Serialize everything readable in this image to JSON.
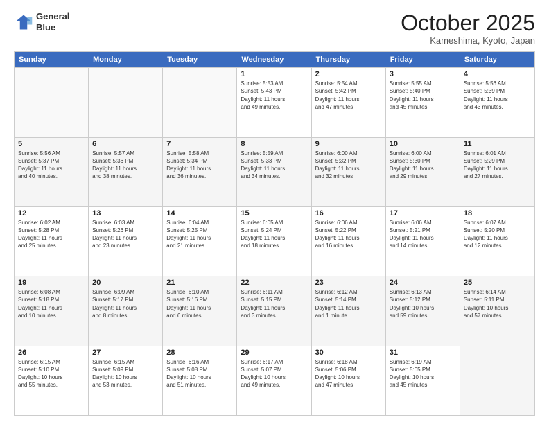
{
  "logo": {
    "line1": "General",
    "line2": "Blue"
  },
  "title": "October 2025",
  "location": "Kameshima, Kyoto, Japan",
  "headers": [
    "Sunday",
    "Monday",
    "Tuesday",
    "Wednesday",
    "Thursday",
    "Friday",
    "Saturday"
  ],
  "weeks": [
    [
      {
        "day": "",
        "info": ""
      },
      {
        "day": "",
        "info": ""
      },
      {
        "day": "",
        "info": ""
      },
      {
        "day": "1",
        "info": "Sunrise: 5:53 AM\nSunset: 5:43 PM\nDaylight: 11 hours\nand 49 minutes."
      },
      {
        "day": "2",
        "info": "Sunrise: 5:54 AM\nSunset: 5:42 PM\nDaylight: 11 hours\nand 47 minutes."
      },
      {
        "day": "3",
        "info": "Sunrise: 5:55 AM\nSunset: 5:40 PM\nDaylight: 11 hours\nand 45 minutes."
      },
      {
        "day": "4",
        "info": "Sunrise: 5:56 AM\nSunset: 5:39 PM\nDaylight: 11 hours\nand 43 minutes."
      }
    ],
    [
      {
        "day": "5",
        "info": "Sunrise: 5:56 AM\nSunset: 5:37 PM\nDaylight: 11 hours\nand 40 minutes."
      },
      {
        "day": "6",
        "info": "Sunrise: 5:57 AM\nSunset: 5:36 PM\nDaylight: 11 hours\nand 38 minutes."
      },
      {
        "day": "7",
        "info": "Sunrise: 5:58 AM\nSunset: 5:34 PM\nDaylight: 11 hours\nand 36 minutes."
      },
      {
        "day": "8",
        "info": "Sunrise: 5:59 AM\nSunset: 5:33 PM\nDaylight: 11 hours\nand 34 minutes."
      },
      {
        "day": "9",
        "info": "Sunrise: 6:00 AM\nSunset: 5:32 PM\nDaylight: 11 hours\nand 32 minutes."
      },
      {
        "day": "10",
        "info": "Sunrise: 6:00 AM\nSunset: 5:30 PM\nDaylight: 11 hours\nand 29 minutes."
      },
      {
        "day": "11",
        "info": "Sunrise: 6:01 AM\nSunset: 5:29 PM\nDaylight: 11 hours\nand 27 minutes."
      }
    ],
    [
      {
        "day": "12",
        "info": "Sunrise: 6:02 AM\nSunset: 5:28 PM\nDaylight: 11 hours\nand 25 minutes."
      },
      {
        "day": "13",
        "info": "Sunrise: 6:03 AM\nSunset: 5:26 PM\nDaylight: 11 hours\nand 23 minutes."
      },
      {
        "day": "14",
        "info": "Sunrise: 6:04 AM\nSunset: 5:25 PM\nDaylight: 11 hours\nand 21 minutes."
      },
      {
        "day": "15",
        "info": "Sunrise: 6:05 AM\nSunset: 5:24 PM\nDaylight: 11 hours\nand 18 minutes."
      },
      {
        "day": "16",
        "info": "Sunrise: 6:06 AM\nSunset: 5:22 PM\nDaylight: 11 hours\nand 16 minutes."
      },
      {
        "day": "17",
        "info": "Sunrise: 6:06 AM\nSunset: 5:21 PM\nDaylight: 11 hours\nand 14 minutes."
      },
      {
        "day": "18",
        "info": "Sunrise: 6:07 AM\nSunset: 5:20 PM\nDaylight: 11 hours\nand 12 minutes."
      }
    ],
    [
      {
        "day": "19",
        "info": "Sunrise: 6:08 AM\nSunset: 5:18 PM\nDaylight: 11 hours\nand 10 minutes."
      },
      {
        "day": "20",
        "info": "Sunrise: 6:09 AM\nSunset: 5:17 PM\nDaylight: 11 hours\nand 8 minutes."
      },
      {
        "day": "21",
        "info": "Sunrise: 6:10 AM\nSunset: 5:16 PM\nDaylight: 11 hours\nand 6 minutes."
      },
      {
        "day": "22",
        "info": "Sunrise: 6:11 AM\nSunset: 5:15 PM\nDaylight: 11 hours\nand 3 minutes."
      },
      {
        "day": "23",
        "info": "Sunrise: 6:12 AM\nSunset: 5:14 PM\nDaylight: 11 hours\nand 1 minute."
      },
      {
        "day": "24",
        "info": "Sunrise: 6:13 AM\nSunset: 5:12 PM\nDaylight: 10 hours\nand 59 minutes."
      },
      {
        "day": "25",
        "info": "Sunrise: 6:14 AM\nSunset: 5:11 PM\nDaylight: 10 hours\nand 57 minutes."
      }
    ],
    [
      {
        "day": "26",
        "info": "Sunrise: 6:15 AM\nSunset: 5:10 PM\nDaylight: 10 hours\nand 55 minutes."
      },
      {
        "day": "27",
        "info": "Sunrise: 6:15 AM\nSunset: 5:09 PM\nDaylight: 10 hours\nand 53 minutes."
      },
      {
        "day": "28",
        "info": "Sunrise: 6:16 AM\nSunset: 5:08 PM\nDaylight: 10 hours\nand 51 minutes."
      },
      {
        "day": "29",
        "info": "Sunrise: 6:17 AM\nSunset: 5:07 PM\nDaylight: 10 hours\nand 49 minutes."
      },
      {
        "day": "30",
        "info": "Sunrise: 6:18 AM\nSunset: 5:06 PM\nDaylight: 10 hours\nand 47 minutes."
      },
      {
        "day": "31",
        "info": "Sunrise: 6:19 AM\nSunset: 5:05 PM\nDaylight: 10 hours\nand 45 minutes."
      },
      {
        "day": "",
        "info": ""
      }
    ]
  ]
}
